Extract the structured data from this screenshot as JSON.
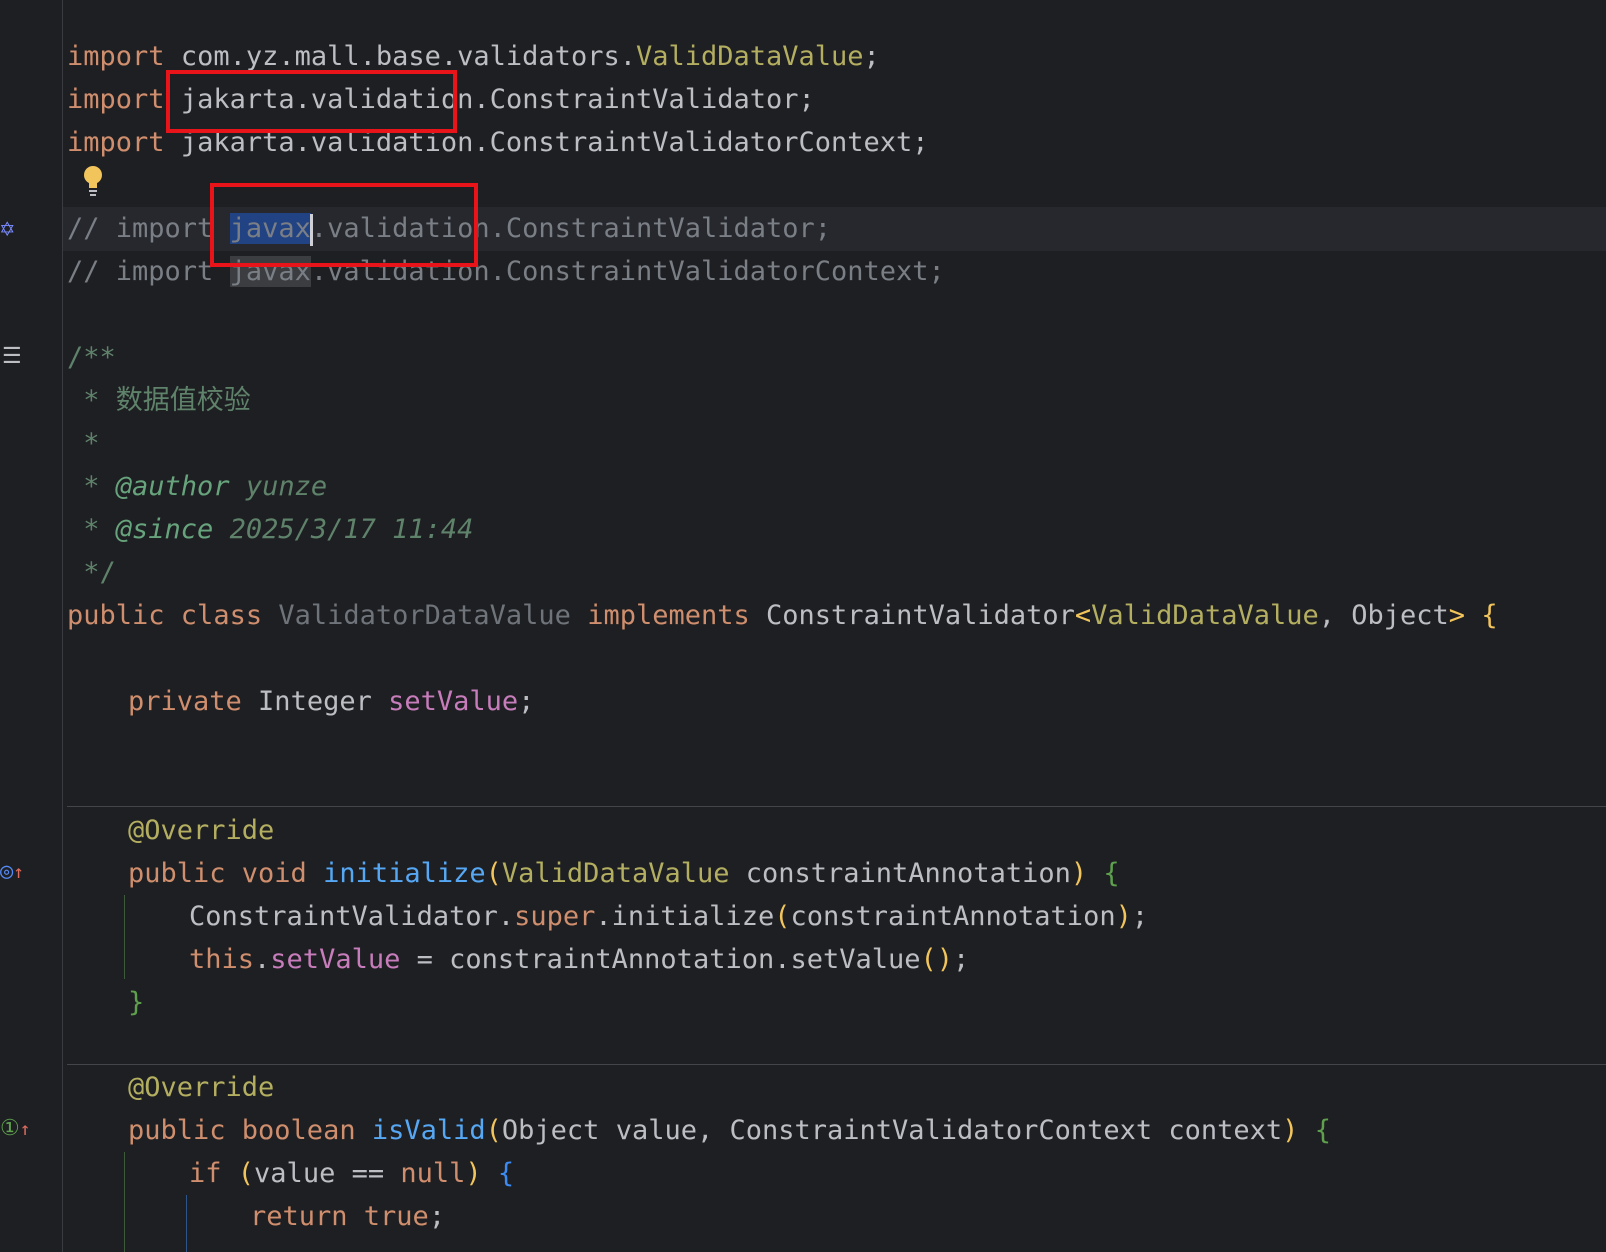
{
  "code": {
    "line1": {
      "kw": "import",
      "pkg": "com.yz.mall.base.validators.",
      "cls": "ValidDataValue",
      "end": ";"
    },
    "line2": {
      "kw": "import",
      "pkg": "jakarta.validation",
      "dot": ".",
      "cls": "ConstraintValidator;"
    },
    "line3": {
      "kw": "import",
      "pkg": "jakarta.validation.ConstraintValidatorContext;"
    },
    "line5": {
      "prefix": "// import ",
      "pkg_sel": "javax",
      "rest": ".validation.ConstraintValidator;"
    },
    "line6": {
      "prefix": "// import ",
      "pkg_occ": "javax",
      "rest": ".validation.ConstraintValidatorContext;"
    },
    "doc_open": "/**",
    "doc_desc": " * 数据值校验",
    "doc_star": " *",
    "doc_author_star": " * ",
    "doc_author_tag": "@author",
    "doc_author_val": " yunze",
    "doc_since_star": " * ",
    "doc_since_tag": "@since",
    "doc_since_val": " 2025/3/17 11:44",
    "doc_close": " */",
    "class_decl": {
      "kw1": "public",
      "kw2": " class ",
      "name": "ValidatorDataValue",
      "kw3": " implements ",
      "iface": "ConstraintValidator",
      "lt": "<",
      "type1": "ValidDataValue",
      "comma": ", ",
      "type2": "Object",
      "gt": ">",
      "brace": " {"
    },
    "field": {
      "kw": "private",
      "type": " Integer ",
      "name": "setValue",
      "end": ";"
    },
    "override1": "@Override",
    "init_sig": {
      "kw": "public void ",
      "name": "initialize",
      "lp": "(",
      "ptype": "ValidDataValue",
      "pname": " constraintAnnotation",
      "rp": ")",
      "brace": " {"
    },
    "init_body1": {
      "a": "ConstraintValidator.",
      "kw": "super",
      "b": ".initialize",
      "lp": "(",
      "arg": "constraintAnnotation",
      "rp": ")",
      "end": ";"
    },
    "init_body2": {
      "kw": "this",
      "dot": ".",
      "field": "setValue",
      "b": " = constraintAnnotation.setValue",
      "lp": "()",
      "end": ";"
    },
    "init_close": "}",
    "override2": "@Override",
    "valid_sig": {
      "kw": "public boolean ",
      "name": "isValid",
      "lp": "(",
      "params": "Object value, ConstraintValidatorContext context",
      "rp": ")",
      "brace": " {"
    },
    "if_line": {
      "kw": "if",
      "sp": " ",
      "lp": "(",
      "cond": "value == ",
      "kw2": "null",
      "rp": ")",
      "brace": " {"
    },
    "return_line": {
      "kw": "return true",
      "end": ";"
    }
  },
  "gutter_icons": {
    "ai": "ai-assistant-icon",
    "doc": "rendered-doc-icon",
    "override1": "implements-method-icon",
    "override2": "implements-method-icon",
    "bulb": "lightbulb-icon"
  }
}
